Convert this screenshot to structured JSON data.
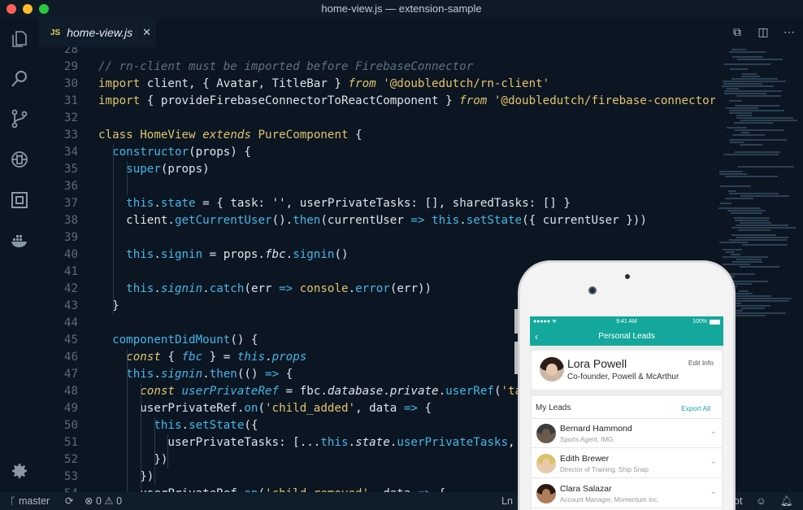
{
  "window": {
    "title": "home-view.js — extension-sample"
  },
  "tab": {
    "icon": "JS",
    "name": "home-view.js",
    "close": "✕"
  },
  "code_lines": [
    {
      "n": "28",
      "html": ""
    },
    {
      "n": "29",
      "html": "<span class='cm'>// rn-client must be imported before FirebaseConnector</span>"
    },
    {
      "n": "30",
      "html": "<span class='kw'>import</span> client, { Avatar, TitleBar } <span class='kw2'>from</span> <span class='str'>'@doubledutch/rn-client'</span>"
    },
    {
      "n": "31",
      "html": "<span class='kw'>import</span> { provideFirebaseConnectorToReactComponent } <span class='kw2'>from</span> <span class='str'>'@doubledutch/firebase-connector'</span>"
    },
    {
      "n": "32",
      "html": ""
    },
    {
      "n": "33",
      "html": "<span class='kw'>class</span> <span class='cls'>HomeView</span> <span class='kw2'>extends</span> <span class='cls'>PureComponent</span> {"
    },
    {
      "n": "34",
      "html": "  <span class='fn'>constructor</span>(props) {"
    },
    {
      "n": "35",
      "html": "    <span class='fn'>super</span>(props)"
    },
    {
      "n": "36",
      "html": ""
    },
    {
      "n": "37",
      "html": "    <span class='th'>this</span>.<span class='fn'>state</span> = { task: '', userPrivateTasks: [], sharedTasks: [] }"
    },
    {
      "n": "38",
      "html": "    client.<span class='fn'>getCurrentUser</span>().<span class='fn'>then</span>(currentUser <span class='fn'>=></span> <span class='th'>this</span>.<span class='fn'>setState</span>({ currentUser }))"
    },
    {
      "n": "39",
      "html": ""
    },
    {
      "n": "40",
      "html": "    <span class='th'>this</span>.<span class='fn'>signin</span> = props.<span class='it'>fbc</span>.<span class='fn'>signin</span>()"
    },
    {
      "n": "41",
      "html": ""
    },
    {
      "n": "42",
      "html": "    <span class='th'>this</span>.<span class='fni'>signin</span>.<span class='fn'>catch</span>(err <span class='fn'>=></span> <span class='kw'>console</span>.<span class='fn'>error</span>(err))"
    },
    {
      "n": "43",
      "html": "  }"
    },
    {
      "n": "44",
      "html": ""
    },
    {
      "n": "45",
      "html": "  <span class='fn'>componentDidMount</span>() {"
    },
    {
      "n": "46",
      "html": "    <span class='kw2'>const</span> { <span class='fni'>fbc</span> } = <span class='th it'>this</span>.<span class='fni'>props</span>"
    },
    {
      "n": "47",
      "html": "    <span class='th'>this</span>.<span class='fni'>signin</span>.<span class='fn'>then</span>(() <span class='fn'>=></span> {"
    },
    {
      "n": "48",
      "html": "      <span class='kw2'>const</span> <span class='fni'>userPrivateRef</span> = fbc.<span class='it'>database</span>.<span class='it'>private</span>.<span class='fn'>userRef</span>(<span class='str'>'ta</span>"
    },
    {
      "n": "49",
      "html": "      userPrivateRef.<span class='fn'>on</span>(<span class='str'>'child_added'</span>, data <span class='fn'>=></span> {"
    },
    {
      "n": "50",
      "html": "        <span class='th'>this</span>.<span class='fn'>setState</span>({"
    },
    {
      "n": "51",
      "html": "          userPrivateTasks: [...<span class='th'>this</span>.<span class='it'>state</span>.<span class='fn'>userPrivateTasks</span>,"
    },
    {
      "n": "52",
      "html": "        })"
    },
    {
      "n": "53",
      "html": "      })"
    },
    {
      "n": "54",
      "html": "      userPrivateRef.<span class='fn'>on</span>(<span class='str'>'child_removed'</span>, data <span class='fn'>=></span> {"
    }
  ],
  "statusbar": {
    "branch": "master",
    "errors": "0",
    "warnings": "0",
    "position": "Ln",
    "right_text": "ot"
  },
  "phone": {
    "status_time": "9:41 AM",
    "battery": "100%",
    "nav_title": "Personal Leads",
    "back": "‹",
    "profile_name": "Lora Powell",
    "profile_title": "Co-founder, Powell & McArthur",
    "edit_info": "Edit Info",
    "leads_title": "My Leads",
    "export_all": "Export All",
    "leads": [
      {
        "name": "Bernard Hammond",
        "title": "Sports Agent, IMG"
      },
      {
        "name": "Edith Brewer",
        "title": "Director of Training, Ship Snap"
      },
      {
        "name": "Clara Salazar",
        "title": "Account Manager, Momentum Inc."
      }
    ]
  },
  "colors": {
    "accent": "#14a89c",
    "background": "#0b1622",
    "keyword": "#e0c46c",
    "function": "#45b6e8"
  }
}
